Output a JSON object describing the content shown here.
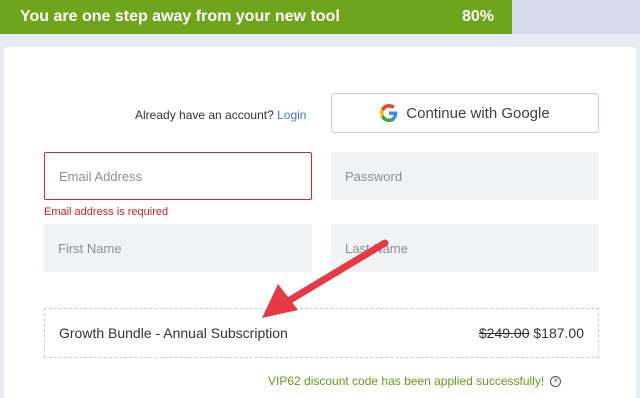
{
  "progress": {
    "text": "You are one step away from your new tool",
    "percent_label": "80%",
    "fraction": 0.8,
    "fill_color": "#6fa51c"
  },
  "auth": {
    "prompt": "Already have an account?",
    "login_label": "Login",
    "google_label": "Continue with Google",
    "google_icon": "google-logo-icon"
  },
  "form": {
    "email_placeholder": "Email Address",
    "email_error": "Email address is required",
    "password_placeholder": "Password",
    "first_name_placeholder": "First Name",
    "last_name_placeholder": "Last Name"
  },
  "order": {
    "product": "Growth Bundle - Annual Subscription",
    "price_old": "$249.00",
    "price_new": "$187.00"
  },
  "discount": {
    "message": "VIP62 discount code has been applied successfully!",
    "remove_icon": "circle-x-icon"
  },
  "colors": {
    "accent_green": "#6fa51c",
    "error_red": "#d32020",
    "annotation_red": "#e63946"
  }
}
